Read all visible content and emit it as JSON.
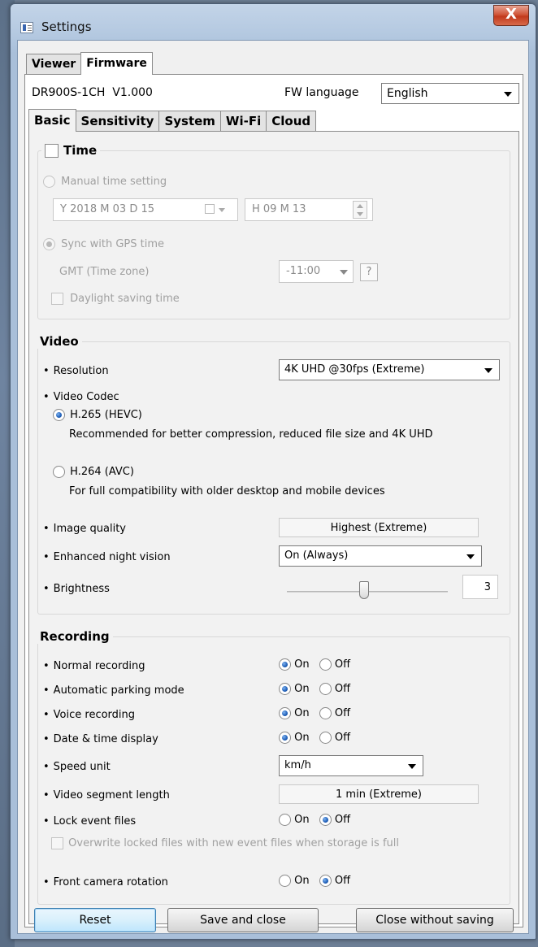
{
  "window": {
    "title": "Settings",
    "close_glyph": "X"
  },
  "top_tabs": [
    {
      "label": "Viewer",
      "active": false
    },
    {
      "label": "Firmware",
      "active": true
    }
  ],
  "device": {
    "model": "DR900S-1CH",
    "version": "V1.000"
  },
  "fw_language": {
    "label": "FW language",
    "value": "English"
  },
  "sub_tabs": [
    {
      "label": "Basic",
      "active": true
    },
    {
      "label": "Sensitivity",
      "active": false
    },
    {
      "label": "System",
      "active": false
    },
    {
      "label": "Wi-Fi",
      "active": false
    },
    {
      "label": "Cloud",
      "active": false
    }
  ],
  "time": {
    "title": "Time",
    "enabled": false,
    "manual_label": "Manual time setting",
    "date_value": "Y 2018 M 03 D 15",
    "time_value": "H 09 M 13",
    "gps_label": "Sync with GPS time",
    "gmt_label": "GMT (Time zone)",
    "gmt_value": "-11:00",
    "help_glyph": "?",
    "dst_label": "Daylight saving time"
  },
  "video": {
    "title": "Video",
    "resolution_label": "Resolution",
    "resolution_value": "4K UHD @30fps (Extreme)",
    "codec_label": "Video Codec",
    "h265_label": "H.265 (HEVC)",
    "h265_desc": "Recommended for better compression, reduced file size and 4K UHD",
    "h264_label": "H.264 (AVC)",
    "h264_desc": "For full compatibility with older desktop and mobile devices",
    "quality_label": "Image quality",
    "quality_value": "Highest (Extreme)",
    "night_label": "Enhanced night vision",
    "night_value": "On (Always)",
    "brightness_label": "Brightness",
    "brightness_value": "3",
    "brightness_fraction": 0.48
  },
  "recording": {
    "title": "Recording",
    "on_label": "On",
    "off_label": "Off",
    "normal_label": "Normal recording",
    "parking_label": "Automatic parking mode",
    "voice_label": "Voice recording",
    "datetime_label": "Date & time display",
    "speed_label": "Speed unit",
    "speed_value": "km/h",
    "segment_label": "Video segment length",
    "segment_value": "1 min (Extreme)",
    "lock_label": "Lock event files",
    "overwrite_label": "Overwrite locked files with new event files when storage is full",
    "rotation_label": "Front camera rotation"
  },
  "footer": {
    "reset": "Reset",
    "save": "Save and close",
    "close": "Close without saving"
  }
}
